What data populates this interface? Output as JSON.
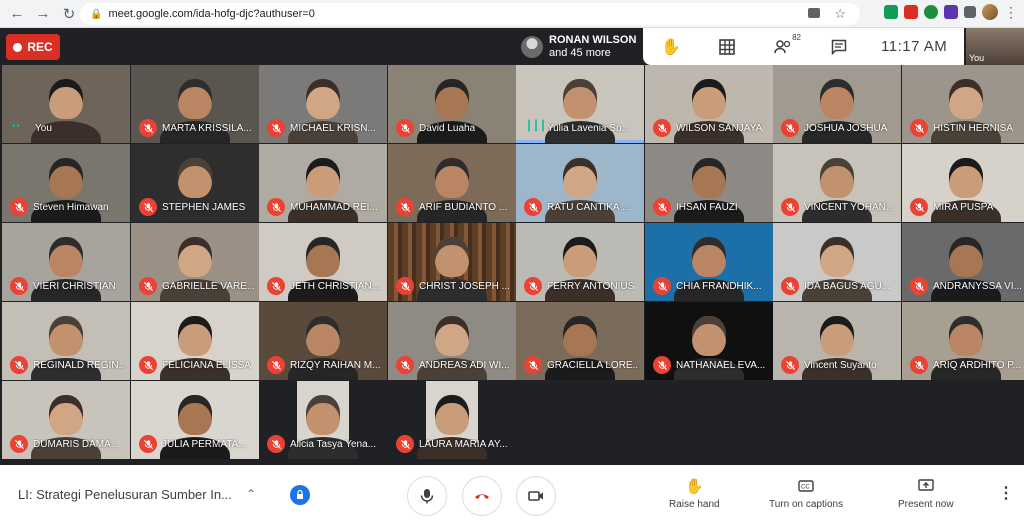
{
  "browser": {
    "url": "meet.google.com/ida-hofg-djc?authuser=0"
  },
  "meet": {
    "rec_label": "REC",
    "presenter": {
      "name": "RONAN WILSON",
      "more": "and 45 more"
    },
    "topbar": {
      "participants_count": "82",
      "time": "11:17 AM"
    },
    "self_label": "You",
    "meeting_title": "LI: Strategi Penelusuran Sumber In...",
    "actions": {
      "raise_hand": "Raise hand",
      "captions": "Turn on captions",
      "present": "Present now"
    },
    "participants": [
      [
        "You",
        "MARTA KRISSILA...",
        "MICHAEL KRISN...",
        "David Luaha",
        "Yulia Lavenia So...",
        "WILSON SANJAYA",
        "JOSHUA JOSHUA",
        "HISTIN HERNISA"
      ],
      [
        "Steven Himawan",
        "STEPHEN JAMES",
        "MUHAMMAD REI...",
        "ARIF BUDIANTO ...",
        "RATU CANTIKA ...",
        "IHSAN FAUZI",
        "VINCENT YOHAN...",
        "MIRA PUSPA"
      ],
      [
        "VIERI CHRISTIAN",
        "GABRIELLE VARE...",
        "JETH CHRISTIAN...",
        "CHRIST JOSEPH ...",
        "FERRY ANTONIUS",
        "CHIA FRANDHIK...",
        "IDA BAGUS AGU...",
        "ANDRANYSSA VI..."
      ],
      [
        "REGINALD REGIN...",
        "FELICIANA ELISSA",
        "RIZQY RAIHAN M...",
        "ANDREAS ADI WI...",
        "GRACIELLA LORE...",
        "NATHANAEL EVA...",
        "Vincent Suyanto",
        "ARIQ ARDHITO P..."
      ],
      [
        "DUMARIS DAMA...",
        "JULIA PERMATA...",
        "Alicia Tasya Yena...",
        "LAURA MARIA AY..."
      ]
    ]
  }
}
